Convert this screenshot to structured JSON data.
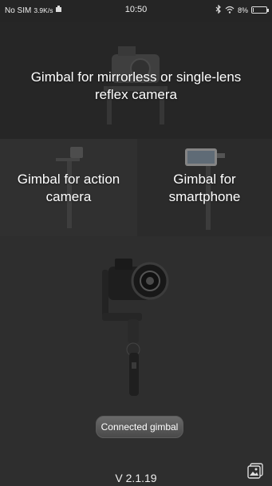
{
  "status_bar": {
    "carrier": "No SIM",
    "net_speed": "3.9K/s",
    "time": "10:50",
    "battery": "8%",
    "battery_level": 0.08,
    "icons": [
      "bluetooth-icon",
      "wifi-icon",
      "battery-icon"
    ]
  },
  "options": {
    "mirrorless": {
      "label": "Gimbal for mirrorless or single-lens reflex camera"
    },
    "action": {
      "label": "Gimbal for action camera"
    },
    "smartphone": {
      "label": "Gimbal for smartphone"
    }
  },
  "connected_button": {
    "label": "Connected gimbal"
  },
  "footer": {
    "version": "V 2.1.19",
    "gallery_icon": "gallery-icon"
  }
}
